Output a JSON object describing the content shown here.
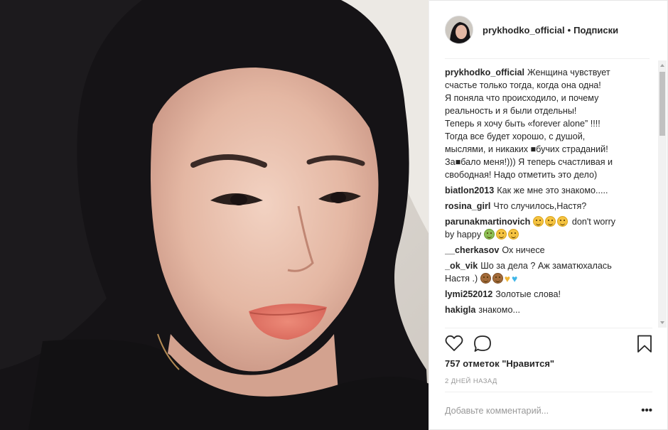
{
  "header": {
    "username": "prykhodko_official",
    "separator": "•",
    "follow_label": "Подписки"
  },
  "caption": {
    "username": "prykhodko_official",
    "lines": [
      "Женщина чувствует",
      "счастье только тогда, когда она одна!",
      "Я поняла что происходило, и почему",
      "реальность и я были отдельны!",
      "Теперь я хочу быть «forever alone” !!!!",
      "Тогда все будет хорошо, с душой,",
      "мыслями, и никаких ■бучих страданий!",
      "За■бало меня!))) Я теперь счастливая и",
      "свободная! Надо отметить это дело)"
    ]
  },
  "comments": [
    {
      "user": "biatlon2013",
      "text": "Как же мне это знакомо....."
    },
    {
      "user": "rosina_girl",
      "text": "Что случилось,Настя?"
    },
    {
      "user": "parunakmartinovich",
      "text_before": "",
      "text_after": " don't worry",
      "text_line2": "by happy"
    },
    {
      "user": "__cherkasov",
      "text": "Ох ничесе"
    },
    {
      "user": "_ok_vik",
      "text": "Шо за дела ? Аж заматюхалась",
      "text_line2": "Настя .)"
    },
    {
      "user": "lymi252012",
      "text": "Золотые слова!"
    },
    {
      "user": "hakigla",
      "text": "знакомо..."
    }
  ],
  "icons": {
    "like": "heart-outline-icon",
    "comment": "speech-bubble-icon",
    "save": "bookmark-icon",
    "more": "ellipsis-icon"
  },
  "likes_text": "757 отметок \"Нравится\"",
  "date_text": "2 ДНЕЙ НАЗАД",
  "add_comment_placeholder": "Добавьте комментарий...",
  "more_label": "•••",
  "colors": {
    "text": "#262626",
    "muted": "#999999",
    "border": "#efefef"
  }
}
